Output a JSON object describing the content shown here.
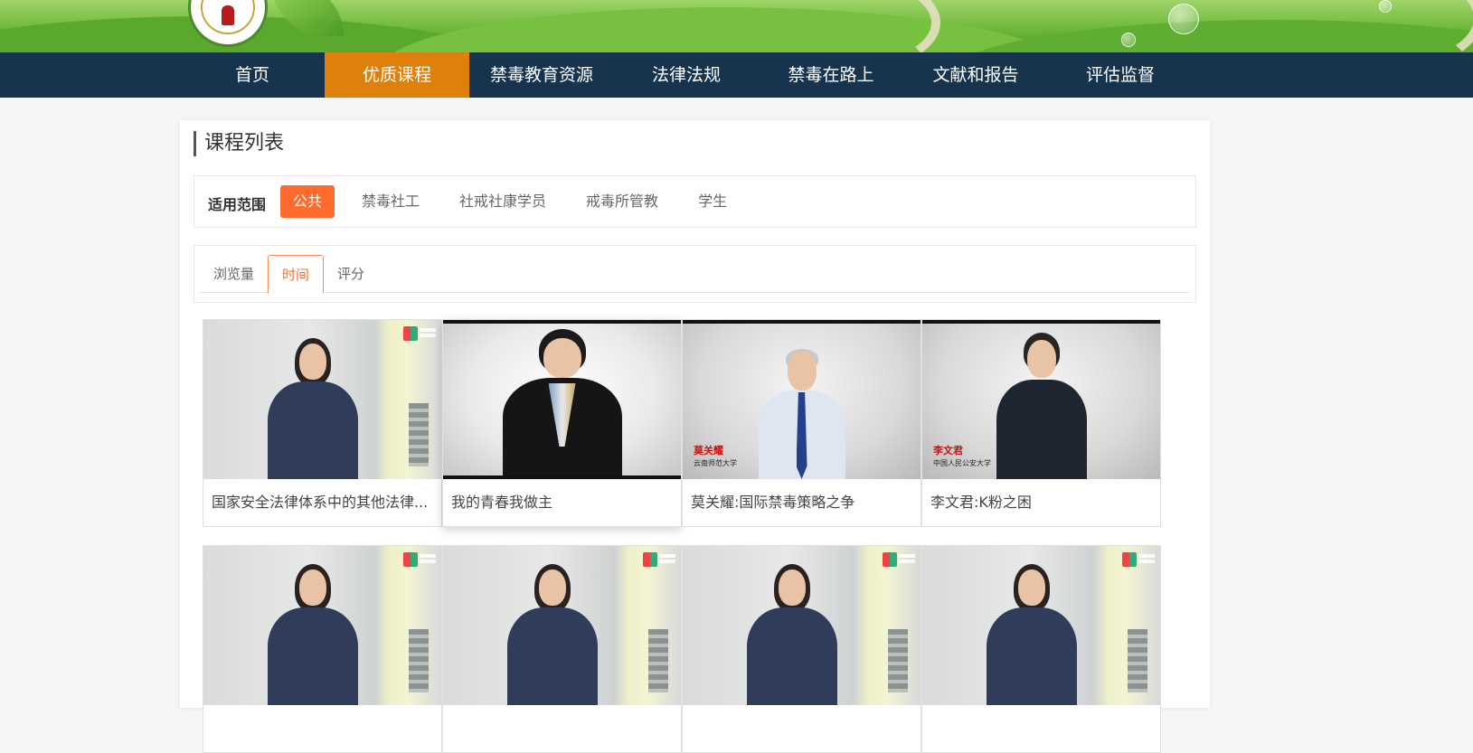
{
  "nav": {
    "items": [
      {
        "label": "首页"
      },
      {
        "label": "优质课程"
      },
      {
        "label": "禁毒教育资源"
      },
      {
        "label": "法律法规"
      },
      {
        "label": "禁毒在路上"
      },
      {
        "label": "文献和报告"
      },
      {
        "label": "评估监督"
      }
    ],
    "active_index": 1
  },
  "page_title": "课程列表",
  "filter": {
    "label": "适用范围",
    "options": [
      {
        "label": "公共"
      },
      {
        "label": "禁毒社工"
      },
      {
        "label": "社戒社康学员"
      },
      {
        "label": "戒毒所管教"
      },
      {
        "label": "学生"
      }
    ],
    "active_index": 0
  },
  "sort": {
    "tabs": [
      {
        "label": "浏览量"
      },
      {
        "label": "时间"
      },
      {
        "label": "评分"
      }
    ],
    "active_index": 1
  },
  "courses": [
    {
      "title": "国家安全法律体系中的其他法律..."
    },
    {
      "title": "我的青春我做主"
    },
    {
      "title": "莫关耀:国际禁毒策略之争",
      "thumb_caption": "莫关耀",
      "thumb_caption_sub": "云南师范大学"
    },
    {
      "title": "李文君:K粉之困",
      "thumb_caption": "李文君",
      "thumb_caption_sub": "中国人民公安大学"
    },
    {
      "title": ""
    },
    {
      "title": ""
    },
    {
      "title": ""
    },
    {
      "title": ""
    }
  ],
  "colors": {
    "nav_bg": "#16344d",
    "nav_active": "#e0800c",
    "accent": "#ff6a2d",
    "banner_green": "#6fb83a"
  }
}
